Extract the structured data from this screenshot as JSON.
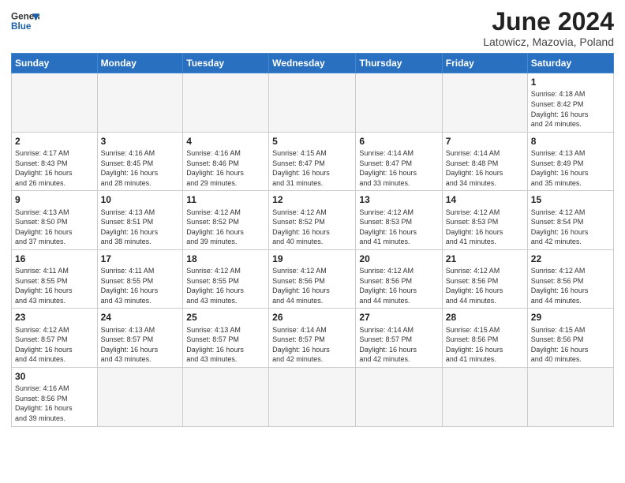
{
  "header": {
    "logo_general": "General",
    "logo_blue": "Blue",
    "month_year": "June 2024",
    "subtitle": "Latowicz, Mazovia, Poland"
  },
  "weekdays": [
    "Sunday",
    "Monday",
    "Tuesday",
    "Wednesday",
    "Thursday",
    "Friday",
    "Saturday"
  ],
  "weeks": [
    [
      {
        "day": "",
        "info": ""
      },
      {
        "day": "",
        "info": ""
      },
      {
        "day": "",
        "info": ""
      },
      {
        "day": "",
        "info": ""
      },
      {
        "day": "",
        "info": ""
      },
      {
        "day": "",
        "info": ""
      },
      {
        "day": "1",
        "info": "Sunrise: 4:18 AM\nSunset: 8:42 PM\nDaylight: 16 hours\nand 24 minutes."
      }
    ],
    [
      {
        "day": "2",
        "info": "Sunrise: 4:17 AM\nSunset: 8:43 PM\nDaylight: 16 hours\nand 26 minutes."
      },
      {
        "day": "3",
        "info": "Sunrise: 4:16 AM\nSunset: 8:45 PM\nDaylight: 16 hours\nand 28 minutes."
      },
      {
        "day": "4",
        "info": "Sunrise: 4:16 AM\nSunset: 8:46 PM\nDaylight: 16 hours\nand 29 minutes."
      },
      {
        "day": "5",
        "info": "Sunrise: 4:15 AM\nSunset: 8:47 PM\nDaylight: 16 hours\nand 31 minutes."
      },
      {
        "day": "6",
        "info": "Sunrise: 4:14 AM\nSunset: 8:47 PM\nDaylight: 16 hours\nand 33 minutes."
      },
      {
        "day": "7",
        "info": "Sunrise: 4:14 AM\nSunset: 8:48 PM\nDaylight: 16 hours\nand 34 minutes."
      },
      {
        "day": "8",
        "info": "Sunrise: 4:13 AM\nSunset: 8:49 PM\nDaylight: 16 hours\nand 35 minutes."
      }
    ],
    [
      {
        "day": "9",
        "info": "Sunrise: 4:13 AM\nSunset: 8:50 PM\nDaylight: 16 hours\nand 37 minutes."
      },
      {
        "day": "10",
        "info": "Sunrise: 4:13 AM\nSunset: 8:51 PM\nDaylight: 16 hours\nand 38 minutes."
      },
      {
        "day": "11",
        "info": "Sunrise: 4:12 AM\nSunset: 8:52 PM\nDaylight: 16 hours\nand 39 minutes."
      },
      {
        "day": "12",
        "info": "Sunrise: 4:12 AM\nSunset: 8:52 PM\nDaylight: 16 hours\nand 40 minutes."
      },
      {
        "day": "13",
        "info": "Sunrise: 4:12 AM\nSunset: 8:53 PM\nDaylight: 16 hours\nand 41 minutes."
      },
      {
        "day": "14",
        "info": "Sunrise: 4:12 AM\nSunset: 8:53 PM\nDaylight: 16 hours\nand 41 minutes."
      },
      {
        "day": "15",
        "info": "Sunrise: 4:12 AM\nSunset: 8:54 PM\nDaylight: 16 hours\nand 42 minutes."
      }
    ],
    [
      {
        "day": "16",
        "info": "Sunrise: 4:11 AM\nSunset: 8:55 PM\nDaylight: 16 hours\nand 43 minutes."
      },
      {
        "day": "17",
        "info": "Sunrise: 4:11 AM\nSunset: 8:55 PM\nDaylight: 16 hours\nand 43 minutes."
      },
      {
        "day": "18",
        "info": "Sunrise: 4:12 AM\nSunset: 8:55 PM\nDaylight: 16 hours\nand 43 minutes."
      },
      {
        "day": "19",
        "info": "Sunrise: 4:12 AM\nSunset: 8:56 PM\nDaylight: 16 hours\nand 44 minutes."
      },
      {
        "day": "20",
        "info": "Sunrise: 4:12 AM\nSunset: 8:56 PM\nDaylight: 16 hours\nand 44 minutes."
      },
      {
        "day": "21",
        "info": "Sunrise: 4:12 AM\nSunset: 8:56 PM\nDaylight: 16 hours\nand 44 minutes."
      },
      {
        "day": "22",
        "info": "Sunrise: 4:12 AM\nSunset: 8:56 PM\nDaylight: 16 hours\nand 44 minutes."
      }
    ],
    [
      {
        "day": "23",
        "info": "Sunrise: 4:12 AM\nSunset: 8:57 PM\nDaylight: 16 hours\nand 44 minutes."
      },
      {
        "day": "24",
        "info": "Sunrise: 4:13 AM\nSunset: 8:57 PM\nDaylight: 16 hours\nand 43 minutes."
      },
      {
        "day": "25",
        "info": "Sunrise: 4:13 AM\nSunset: 8:57 PM\nDaylight: 16 hours\nand 43 minutes."
      },
      {
        "day": "26",
        "info": "Sunrise: 4:14 AM\nSunset: 8:57 PM\nDaylight: 16 hours\nand 42 minutes."
      },
      {
        "day": "27",
        "info": "Sunrise: 4:14 AM\nSunset: 8:57 PM\nDaylight: 16 hours\nand 42 minutes."
      },
      {
        "day": "28",
        "info": "Sunrise: 4:15 AM\nSunset: 8:56 PM\nDaylight: 16 hours\nand 41 minutes."
      },
      {
        "day": "29",
        "info": "Sunrise: 4:15 AM\nSunset: 8:56 PM\nDaylight: 16 hours\nand 40 minutes."
      }
    ],
    [
      {
        "day": "30",
        "info": "Sunrise: 4:16 AM\nSunset: 8:56 PM\nDaylight: 16 hours\nand 39 minutes."
      },
      {
        "day": "",
        "info": ""
      },
      {
        "day": "",
        "info": ""
      },
      {
        "day": "",
        "info": ""
      },
      {
        "day": "",
        "info": ""
      },
      {
        "day": "",
        "info": ""
      },
      {
        "day": "",
        "info": ""
      }
    ]
  ]
}
